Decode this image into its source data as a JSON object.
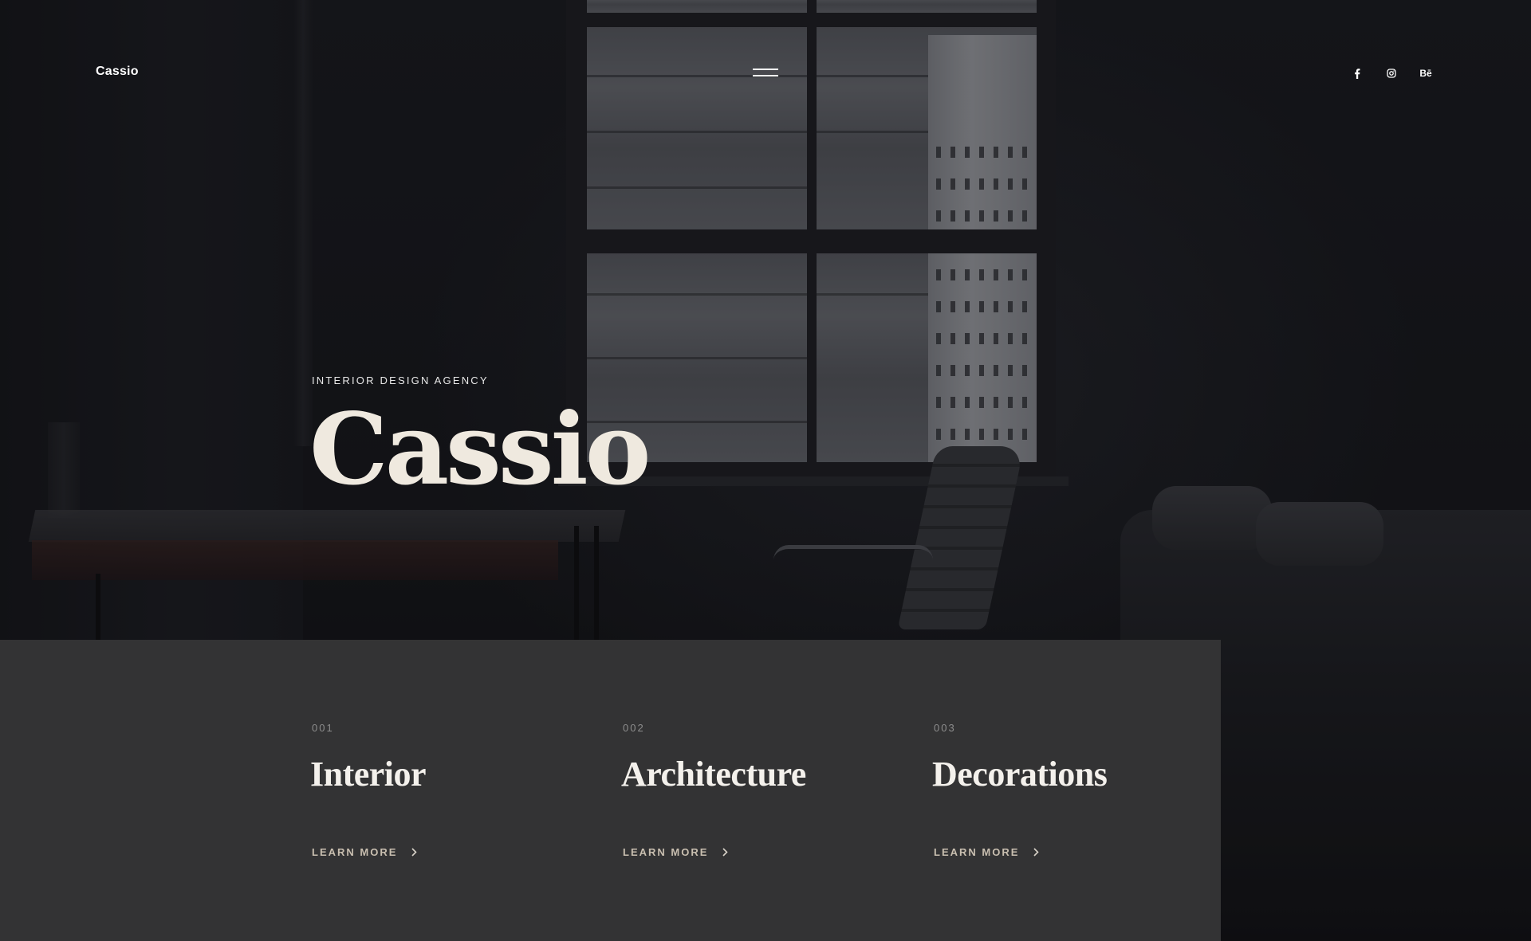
{
  "header": {
    "logo": "Cassio",
    "menu_icon": "hamburger-menu-icon",
    "social": [
      {
        "name": "facebook-icon",
        "label": "f"
      },
      {
        "name": "instagram-icon",
        "label": ""
      },
      {
        "name": "behance-icon",
        "label": "Bē"
      }
    ]
  },
  "hero": {
    "eyebrow": "INTERIOR DESIGN AGENCY",
    "title": "Cassio"
  },
  "services": [
    {
      "number": "001",
      "title": "Interior",
      "link": "LEARN MORE"
    },
    {
      "number": "002",
      "title": "Architecture",
      "link": "LEARN MORE"
    },
    {
      "number": "003",
      "title": "Decorations",
      "link": "LEARN MORE"
    }
  ],
  "colors": {
    "panel_bg": "#333334",
    "hero_title": "#efe9df",
    "link": "#c9bfb0",
    "number": "#8d8d8d"
  }
}
